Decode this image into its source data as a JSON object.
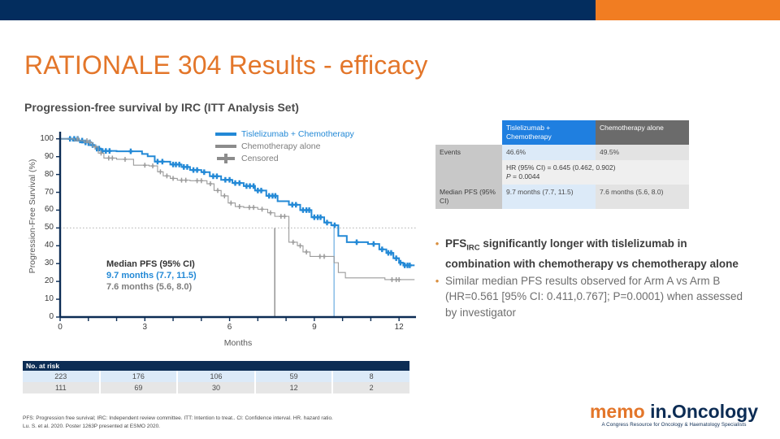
{
  "theme": {
    "navy": "#032d5e",
    "orange": "#f17d22",
    "blue": "#1f7fe0",
    "grey": "#8c8c8c"
  },
  "header": {
    "title": "RATIONALE 304 Results - efficacy",
    "subtitle": "Progression-free survival by IRC (ITT Analysis Set)"
  },
  "chart_data": {
    "type": "line",
    "title": "Progression-free survival by IRC (ITT Analysis Set)",
    "xlabel": "Months",
    "ylabel": "Progression-Free Survival (%)",
    "xlim": [
      0,
      12.6
    ],
    "ylim": [
      0,
      104
    ],
    "xticks": [
      0,
      1,
      2,
      3,
      4,
      5,
      6,
      7,
      8,
      9,
      10,
      11,
      12
    ],
    "xticklabels": [
      {
        "v": 0,
        "label": "0"
      },
      {
        "v": 3,
        "label": "3"
      },
      {
        "v": 6,
        "label": "6"
      },
      {
        "v": 9,
        "label": "9"
      },
      {
        "v": 12,
        "label": "12"
      }
    ],
    "yticks": [
      0,
      10,
      20,
      30,
      40,
      50,
      60,
      70,
      80,
      90,
      100
    ],
    "yticklabels": [
      "0",
      "10",
      "20",
      "30",
      "40",
      "50",
      "60",
      "70",
      "80",
      "90",
      "100"
    ],
    "grid": false,
    "reference_line": {
      "y": 50,
      "style": "dotted",
      "color": "#b0b0b0"
    },
    "median_markers": [
      {
        "x": 7.6,
        "y": 50,
        "color": "#9b9b9b"
      },
      {
        "x": 9.7,
        "y": 50,
        "color": "#8fc0e8"
      }
    ],
    "legend_position": "top-right",
    "series": [
      {
        "name": "Tislelizumab + Chemotherapy",
        "color": "#2389d6",
        "steps": [
          [
            0,
            100
          ],
          [
            0.45,
            100
          ],
          [
            0.45,
            99
          ],
          [
            0.7,
            99
          ],
          [
            0.7,
            98
          ],
          [
            1.0,
            98
          ],
          [
            1.0,
            96.5
          ],
          [
            1.25,
            96.5
          ],
          [
            1.25,
            94.5
          ],
          [
            1.45,
            94.5
          ],
          [
            1.45,
            93.2
          ],
          [
            2.0,
            93.2
          ],
          [
            2.0,
            93.0
          ],
          [
            2.9,
            93.0
          ],
          [
            2.9,
            91.5
          ],
          [
            3.1,
            91.5
          ],
          [
            3.1,
            90.2
          ],
          [
            3.35,
            90.2
          ],
          [
            3.35,
            87.2
          ],
          [
            3.9,
            87.2
          ],
          [
            3.9,
            85.6
          ],
          [
            4.3,
            85.6
          ],
          [
            4.3,
            84.2
          ],
          [
            4.6,
            84.2
          ],
          [
            4.6,
            82.5
          ],
          [
            5.0,
            82.5
          ],
          [
            5.0,
            81.3
          ],
          [
            5.3,
            81.3
          ],
          [
            5.3,
            79.0
          ],
          [
            5.7,
            79.0
          ],
          [
            5.7,
            77.0
          ],
          [
            6.1,
            77.0
          ],
          [
            6.1,
            75.2
          ],
          [
            6.5,
            75.2
          ],
          [
            6.5,
            73.5
          ],
          [
            6.9,
            73.5
          ],
          [
            6.9,
            71.0
          ],
          [
            7.3,
            71.0
          ],
          [
            7.3,
            68.0
          ],
          [
            7.7,
            68.0
          ],
          [
            7.7,
            65.0
          ],
          [
            8.1,
            65.0
          ],
          [
            8.1,
            63.0
          ],
          [
            8.5,
            63.0
          ],
          [
            8.5,
            60.0
          ],
          [
            8.9,
            60.0
          ],
          [
            8.9,
            56.0
          ],
          [
            9.35,
            56.0
          ],
          [
            9.35,
            53.0
          ],
          [
            9.6,
            53.0
          ],
          [
            9.6,
            51.5
          ],
          [
            9.85,
            51.5
          ],
          [
            9.85,
            45.5
          ],
          [
            10.15,
            45.5
          ],
          [
            10.15,
            42.0
          ],
          [
            10.9,
            42.0
          ],
          [
            10.9,
            41.0
          ],
          [
            11.3,
            41.0
          ],
          [
            11.3,
            38.0
          ],
          [
            11.55,
            38.0
          ],
          [
            11.55,
            36.0
          ],
          [
            11.8,
            36.0
          ],
          [
            11.8,
            33.0
          ],
          [
            12.0,
            33.0
          ],
          [
            12.0,
            30.5
          ],
          [
            12.15,
            30.5
          ],
          [
            12.15,
            29.0
          ],
          [
            12.55,
            29.0
          ]
        ],
        "censored": [
          [
            0.35,
            100
          ],
          [
            0.5,
            100
          ],
          [
            0.62,
            100
          ],
          [
            0.78,
            99
          ],
          [
            0.9,
            98
          ],
          [
            1.05,
            98
          ],
          [
            1.15,
            96.5
          ],
          [
            1.3,
            94.5
          ],
          [
            1.38,
            94.5
          ],
          [
            1.5,
            93.2
          ],
          [
            1.62,
            93.2
          ],
          [
            1.75,
            93.2
          ],
          [
            2.5,
            93.0
          ],
          [
            3.45,
            87.2
          ],
          [
            3.62,
            87.2
          ],
          [
            4.0,
            85.6
          ],
          [
            4.1,
            85.6
          ],
          [
            4.22,
            85.6
          ],
          [
            4.38,
            84.2
          ],
          [
            4.5,
            84.2
          ],
          [
            4.72,
            82.5
          ],
          [
            4.85,
            82.5
          ],
          [
            5.1,
            81.3
          ],
          [
            5.42,
            79.0
          ],
          [
            5.55,
            79.0
          ],
          [
            5.85,
            77.0
          ],
          [
            6.0,
            77.0
          ],
          [
            6.2,
            75.2
          ],
          [
            6.35,
            75.2
          ],
          [
            6.6,
            73.5
          ],
          [
            6.72,
            73.5
          ],
          [
            6.85,
            73.5
          ],
          [
            7.0,
            71.0
          ],
          [
            7.12,
            71.0
          ],
          [
            7.4,
            68.0
          ],
          [
            7.52,
            68.0
          ],
          [
            7.62,
            68.0
          ],
          [
            8.22,
            63.0
          ],
          [
            8.35,
            63.0
          ],
          [
            8.6,
            60.0
          ],
          [
            8.72,
            60.0
          ],
          [
            8.82,
            60.0
          ],
          [
            9.0,
            56.0
          ],
          [
            9.12,
            56.0
          ],
          [
            9.22,
            56.0
          ],
          [
            9.45,
            53.0
          ],
          [
            9.72,
            51.5
          ],
          [
            10.5,
            42.0
          ],
          [
            11.1,
            41.0
          ],
          [
            11.4,
            38.0
          ],
          [
            11.62,
            36.0
          ],
          [
            11.72,
            36.0
          ],
          [
            11.9,
            33.0
          ],
          [
            12.05,
            30.5
          ],
          [
            12.2,
            29.0
          ],
          [
            12.3,
            29.0
          ],
          [
            12.38,
            29.0
          ]
        ]
      },
      {
        "name": "Chemotherapy alone",
        "color": "#9b9b9b",
        "steps": [
          [
            0,
            100
          ],
          [
            0.5,
            100
          ],
          [
            0.5,
            99
          ],
          [
            0.85,
            99
          ],
          [
            0.85,
            98
          ],
          [
            1.15,
            98
          ],
          [
            1.15,
            95.5
          ],
          [
            1.35,
            95.5
          ],
          [
            1.35,
            92.0
          ],
          [
            1.55,
            92.0
          ],
          [
            1.55,
            89.2
          ],
          [
            2.0,
            89.2
          ],
          [
            2.0,
            88.5
          ],
          [
            2.6,
            88.5
          ],
          [
            2.6,
            85.2
          ],
          [
            3.15,
            85.2
          ],
          [
            3.15,
            84.8
          ],
          [
            3.45,
            84.8
          ],
          [
            3.45,
            81.5
          ],
          [
            3.65,
            81.5
          ],
          [
            3.65,
            79.2
          ],
          [
            3.9,
            79.2
          ],
          [
            3.9,
            77.8
          ],
          [
            4.15,
            77.8
          ],
          [
            4.15,
            76.8
          ],
          [
            4.6,
            76.8
          ],
          [
            4.6,
            76.5
          ],
          [
            5.2,
            76.5
          ],
          [
            5.2,
            74.8
          ],
          [
            5.45,
            74.8
          ],
          [
            5.45,
            71.0
          ],
          [
            5.7,
            71.0
          ],
          [
            5.7,
            68.0
          ],
          [
            5.95,
            68.0
          ],
          [
            5.95,
            64.0
          ],
          [
            6.2,
            64.0
          ],
          [
            6.2,
            62.0
          ],
          [
            6.5,
            62.0
          ],
          [
            6.5,
            61.5
          ],
          [
            7.0,
            61.5
          ],
          [
            7.0,
            60.5
          ],
          [
            7.35,
            60.5
          ],
          [
            7.35,
            58.5
          ],
          [
            7.6,
            58.5
          ],
          [
            7.6,
            56.5
          ],
          [
            8.1,
            56.5
          ],
          [
            8.1,
            42.0
          ],
          [
            8.4,
            42.0
          ],
          [
            8.4,
            40.0
          ],
          [
            8.6,
            40.0
          ],
          [
            8.6,
            36.5
          ],
          [
            8.85,
            36.5
          ],
          [
            8.85,
            34.0
          ],
          [
            9.7,
            34.0
          ],
          [
            9.7,
            30.5
          ],
          [
            9.85,
            30.5
          ],
          [
            9.85,
            25.0
          ],
          [
            10.1,
            25.0
          ],
          [
            10.1,
            22.0
          ],
          [
            11.5,
            22.0
          ],
          [
            11.5,
            21.0
          ],
          [
            12.55,
            21.0
          ]
        ],
        "censored": [
          [
            0.62,
            100
          ],
          [
            0.95,
            99
          ],
          [
            1.05,
            98
          ],
          [
            1.25,
            95.5
          ],
          [
            1.45,
            92.0
          ],
          [
            1.72,
            89.2
          ],
          [
            1.85,
            89.2
          ],
          [
            2.3,
            88.5
          ],
          [
            3.0,
            85.2
          ],
          [
            3.28,
            84.8
          ],
          [
            3.55,
            81.5
          ],
          [
            3.78,
            79.2
          ],
          [
            4.0,
            77.8
          ],
          [
            4.3,
            76.8
          ],
          [
            4.45,
            76.8
          ],
          [
            4.85,
            76.5
          ],
          [
            5.0,
            76.5
          ],
          [
            5.32,
            74.8
          ],
          [
            5.58,
            71.0
          ],
          [
            5.82,
            68.0
          ],
          [
            6.05,
            64.0
          ],
          [
            6.35,
            62.0
          ],
          [
            6.7,
            61.5
          ],
          [
            6.85,
            61.5
          ],
          [
            7.15,
            60.5
          ],
          [
            7.45,
            58.5
          ],
          [
            7.82,
            56.5
          ],
          [
            7.95,
            56.5
          ],
          [
            8.25,
            42.0
          ],
          [
            8.5,
            40.0
          ],
          [
            8.72,
            36.5
          ],
          [
            9.2,
            34.0
          ],
          [
            9.35,
            34.0
          ],
          [
            11.75,
            21.0
          ],
          [
            11.9,
            21.0
          ],
          [
            12.0,
            21.0
          ]
        ]
      }
    ],
    "annotation": {
      "heading": "Median PFS (95% CI)",
      "line_blue": "9.7 months (7.7, 11.5)",
      "line_grey": "7.6 months (5.6, 8.0)",
      "heading_color": "#333333",
      "blue_color": "#2389d6",
      "grey_color": "#7d7d7d"
    },
    "legend": [
      {
        "label": "Tislelizumab + Chemotherapy",
        "color": "#2389d6",
        "marker": "line",
        "text_color": "#2389d6"
      },
      {
        "label": "Chemotherapy alone",
        "color": "#8c8c8c",
        "marker": "line",
        "text_color": "#7d7d7d"
      },
      {
        "label": "Censored",
        "color": "#8c8c8c",
        "marker": "cross",
        "text_color": "#7d7d7d"
      }
    ]
  },
  "results_table": {
    "col_headers": [
      "",
      "Tislelizumab + Chemotherapy",
      "Chemotherapy alone"
    ],
    "rows": [
      {
        "label": "Events",
        "arm_a": "46.6%",
        "arm_b": "49.5%"
      },
      {
        "label": "Median PFS (95% CI)",
        "arm_a": "9.7 months (7.7, 11.5)",
        "arm_b": "7.6 months (5.6, 8.0)"
      }
    ],
    "hr_line1": "HR (95% CI) = 0.645 (0.462, 0.902)",
    "hr_line2_italic": "P",
    "hr_line2_rest": " = 0.0044"
  },
  "bullets": [
    {
      "pre": "PFS",
      "sub": "IRC",
      "post": " significantly longer with tislelizumab in combination with chemotherapy vs chemotherapy alone",
      "bold": true
    },
    {
      "pre": "",
      "sub": "",
      "post": "Similar median PFS results observed for Arm A vs Arm B (HR=0.561 [95% CI: 0.411,0.767]; P=0.0001) when assessed by investigator",
      "bold": false
    }
  ],
  "risk_table": {
    "title": "No. at risk",
    "rows": [
      {
        "arm": "Tislelizumab + Chemotherapy",
        "values": [
          "223",
          "176",
          "106",
          "59",
          "8"
        ]
      },
      {
        "arm": "Chemotherapy alone",
        "values": [
          "111",
          "69",
          "30",
          "12",
          "2"
        ]
      }
    ]
  },
  "footnote": {
    "line1": "PFS: Progression free survival; IRC: Independent review committee. ITT: Intention to treat.. CI: Confidence interval. HR. hazard ratio.",
    "line2": "Lu. S. et al. 2020. Poster 1263P presented at ESMO 2020."
  },
  "logo": {
    "memo": "memo",
    "inoncology": "in.Oncology",
    "tagline": "A Congress Resource for Oncology & Haematology Specialists"
  }
}
